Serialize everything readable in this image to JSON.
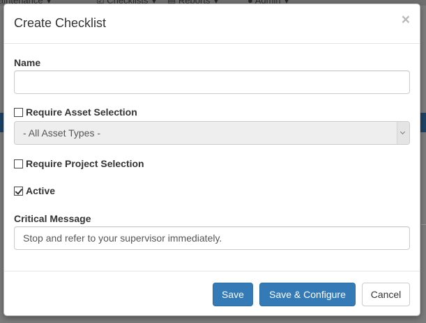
{
  "background": {
    "nav_items": [
      {
        "label": "aintenance"
      },
      {
        "label": "Checklists"
      },
      {
        "label": "Reports"
      },
      {
        "label": "Admin"
      }
    ]
  },
  "modal": {
    "title": "Create Checklist",
    "close_glyph": "×",
    "name_field": {
      "label": "Name",
      "value": "",
      "placeholder": ""
    },
    "require_asset": {
      "label": "Require Asset Selection",
      "checked": false
    },
    "asset_type_select": {
      "selected": "- All Asset Types -",
      "disabled": true
    },
    "require_project": {
      "label": "Require Project Selection",
      "checked": false
    },
    "active": {
      "label": "Active",
      "checked": true
    },
    "critical_message": {
      "label": "Critical Message",
      "value": "Stop and refer to your supervisor immediately."
    },
    "footer": {
      "save_label": "Save",
      "save_configure_label": "Save & Configure",
      "cancel_label": "Cancel"
    }
  },
  "colors": {
    "primary": "#337ab7",
    "overlay": "#808080"
  }
}
